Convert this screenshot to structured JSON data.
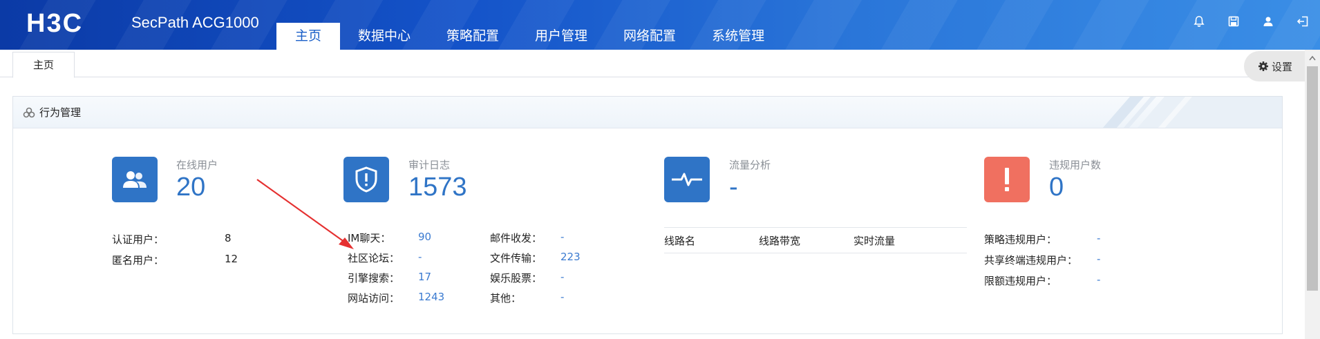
{
  "header": {
    "logo_text": "H3C",
    "product": "SecPath ACG1000",
    "nav": [
      "主页",
      "数据中心",
      "策略配置",
      "用户管理",
      "网络配置",
      "系统管理"
    ],
    "icons": [
      "bell-icon",
      "save-icon",
      "user-icon",
      "logout-icon"
    ]
  },
  "tabs": {
    "home": "主页",
    "settings": "设置"
  },
  "panel": {
    "title": "行为管理",
    "online_users": {
      "label": "在线用户",
      "value": "20",
      "rows": [
        {
          "label": "认证用户：",
          "value": "8"
        },
        {
          "label": "匿名用户：",
          "value": "12"
        }
      ]
    },
    "audit_log": {
      "label": "审计日志",
      "value": "1573",
      "left": [
        {
          "label": "IM聊天：",
          "value": "90"
        },
        {
          "label": "社区论坛：",
          "value": "-"
        },
        {
          "label": "引擎搜索：",
          "value": "17"
        },
        {
          "label": "网站访问：",
          "value": "1243"
        }
      ],
      "right": [
        {
          "label": "邮件收发：",
          "value": "-"
        },
        {
          "label": "文件传输：",
          "value": "223"
        },
        {
          "label": "娱乐股票：",
          "value": "-"
        },
        {
          "label": "其他：",
          "value": "-"
        }
      ]
    },
    "traffic": {
      "label": "流量分析",
      "value": "-",
      "columns": [
        "线路名",
        "线路带宽",
        "实时流量"
      ]
    },
    "violations": {
      "label": "违规用户数",
      "value": "0",
      "rows": [
        {
          "label": "策略违规用户：",
          "value": "-"
        },
        {
          "label": "共享终端违规用户：",
          "value": "-"
        },
        {
          "label": "限额违规用户：",
          "value": "-"
        }
      ]
    }
  },
  "colors": {
    "accent": "#2f74c6",
    "header_blue": "#1453c9",
    "violation_red": "#f07060",
    "annotation_arrow": "#e53030"
  }
}
